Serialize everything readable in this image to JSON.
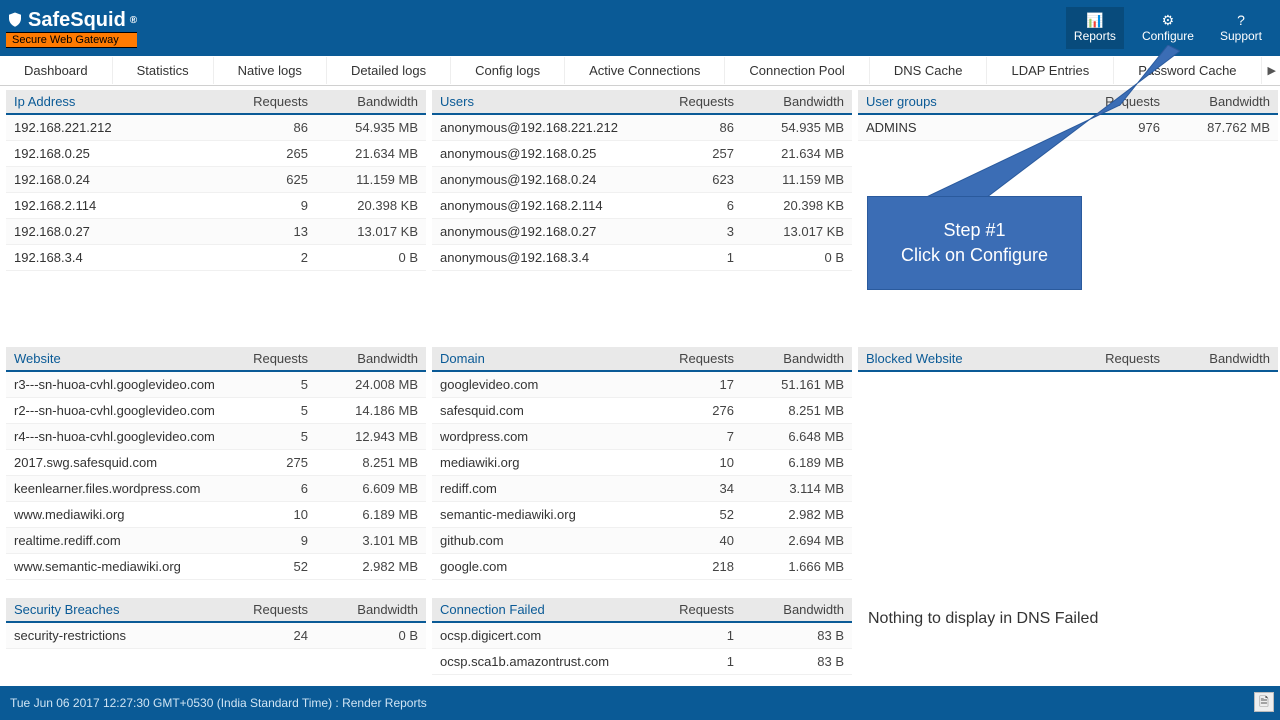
{
  "brand": {
    "name": "SafeSquid",
    "reg": "®",
    "tagline": "Secure Web Gateway"
  },
  "top_actions": [
    {
      "icon": "📊",
      "label": "Reports",
      "active": true
    },
    {
      "icon": "⚙",
      "label": "Configure",
      "active": false
    },
    {
      "icon": "?",
      "label": "Support",
      "active": false
    }
  ],
  "tabs": [
    "Dashboard",
    "Statistics",
    "Native logs",
    "Detailed logs",
    "Config logs",
    "Active Connections",
    "Connection Pool",
    "DNS Cache",
    "LDAP Entries",
    "Password Cache"
  ],
  "headers": {
    "requests": "Requests",
    "bandwidth": "Bandwidth"
  },
  "panels": {
    "ip": {
      "title": "Ip Address",
      "rows": [
        {
          "a": "192.168.221.212",
          "b": "86",
          "c": "54.935 MB"
        },
        {
          "a": "192.168.0.25",
          "b": "265",
          "c": "21.634 MB"
        },
        {
          "a": "192.168.0.24",
          "b": "625",
          "c": "11.159 MB"
        },
        {
          "a": "192.168.2.114",
          "b": "9",
          "c": "20.398 KB"
        },
        {
          "a": "192.168.0.27",
          "b": "13",
          "c": "13.017 KB"
        },
        {
          "a": "192.168.3.4",
          "b": "2",
          "c": "0 B"
        }
      ]
    },
    "users": {
      "title": "Users",
      "rows": [
        {
          "a": "anonymous@192.168.221.212",
          "b": "86",
          "c": "54.935 MB"
        },
        {
          "a": "anonymous@192.168.0.25",
          "b": "257",
          "c": "21.634 MB"
        },
        {
          "a": "anonymous@192.168.0.24",
          "b": "623",
          "c": "11.159 MB"
        },
        {
          "a": "anonymous@192.168.2.114",
          "b": "6",
          "c": "20.398 KB"
        },
        {
          "a": "anonymous@192.168.0.27",
          "b": "3",
          "c": "13.017 KB"
        },
        {
          "a": "anonymous@192.168.3.4",
          "b": "1",
          "c": "0 B"
        }
      ]
    },
    "groups": {
      "title": "User groups",
      "rows": [
        {
          "a": "ADMINS",
          "b": "976",
          "c": "87.762 MB"
        }
      ]
    },
    "website": {
      "title": "Website",
      "rows": [
        {
          "a": "r3---sn-huoa-cvhl.googlevideo.com",
          "b": "5",
          "c": "24.008 MB"
        },
        {
          "a": "r2---sn-huoa-cvhl.googlevideo.com",
          "b": "5",
          "c": "14.186 MB"
        },
        {
          "a": "r4---sn-huoa-cvhl.googlevideo.com",
          "b": "5",
          "c": "12.943 MB"
        },
        {
          "a": "2017.swg.safesquid.com",
          "b": "275",
          "c": "8.251 MB"
        },
        {
          "a": "keenlearner.files.wordpress.com",
          "b": "6",
          "c": "6.609 MB"
        },
        {
          "a": "www.mediawiki.org",
          "b": "10",
          "c": "6.189 MB"
        },
        {
          "a": "realtime.rediff.com",
          "b": "9",
          "c": "3.101 MB"
        },
        {
          "a": "www.semantic-mediawiki.org",
          "b": "52",
          "c": "2.982 MB"
        }
      ]
    },
    "domain": {
      "title": "Domain",
      "rows": [
        {
          "a": "googlevideo.com",
          "b": "17",
          "c": "51.161 MB"
        },
        {
          "a": "safesquid.com",
          "b": "276",
          "c": "8.251 MB"
        },
        {
          "a": "wordpress.com",
          "b": "7",
          "c": "6.648 MB"
        },
        {
          "a": "mediawiki.org",
          "b": "10",
          "c": "6.189 MB"
        },
        {
          "a": "rediff.com",
          "b": "34",
          "c": "3.114 MB"
        },
        {
          "a": "semantic-mediawiki.org",
          "b": "52",
          "c": "2.982 MB"
        },
        {
          "a": "github.com",
          "b": "40",
          "c": "2.694 MB"
        },
        {
          "a": "google.com",
          "b": "218",
          "c": "1.666 MB"
        }
      ]
    },
    "blocked": {
      "title": "Blocked Website",
      "rows": []
    },
    "breaches": {
      "title": "Security Breaches",
      "rows": [
        {
          "a": "security-restrictions",
          "b": "24",
          "c": "0 B"
        }
      ]
    },
    "connfail": {
      "title": "Connection Failed",
      "rows": [
        {
          "a": "ocsp.digicert.com",
          "b": "1",
          "c": "83 B"
        },
        {
          "a": "ocsp.sca1b.amazontrust.com",
          "b": "1",
          "c": "83 B"
        }
      ]
    },
    "dnsfail": {
      "title": "",
      "empty": "Nothing to display in DNS Failed"
    }
  },
  "callout": {
    "line1": "Step #1",
    "line2": "Click on Configure"
  },
  "footer": "Tue Jun 06 2017 12:27:30 GMT+0530 (India Standard Time) : Render Reports"
}
